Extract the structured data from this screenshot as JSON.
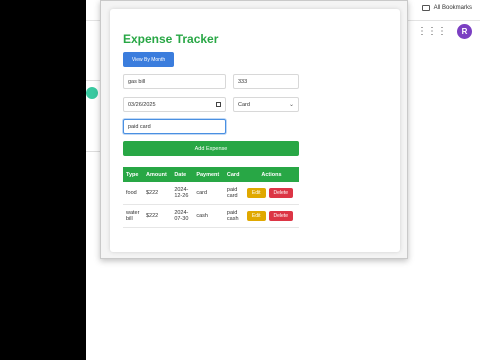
{
  "browser": {
    "bookmarks_label": "All Bookmarks",
    "profile_initial": "R",
    "profile_color": "#7b3fc2"
  },
  "app": {
    "title": "Expense Tracker",
    "view_by_month_label": "View By Month",
    "description_value": "gas bill",
    "amount_value": "333",
    "date_value": "03/26/2025",
    "payment_value": "Card",
    "card_value": "paid card",
    "add_label": "Add Expense"
  },
  "table": {
    "headers": [
      "Type",
      "Amount",
      "Date",
      "Payment",
      "Card",
      "Actions"
    ],
    "rows": [
      {
        "type": "food",
        "amount": "$222",
        "date": "2024-12-26",
        "payment": "card",
        "card": "paid card",
        "edit": "Edit",
        "delete": "Delete"
      },
      {
        "type": "water bill",
        "amount": "$222",
        "date": "2024-07-30",
        "payment": "cash",
        "card": "paid cash",
        "edit": "Edit",
        "delete": "Delete"
      }
    ]
  },
  "colors": {
    "accent_green": "#28a745",
    "primary_blue": "#3b7ddd",
    "edit_yellow": "#e0a800",
    "delete_red": "#dc3545"
  }
}
